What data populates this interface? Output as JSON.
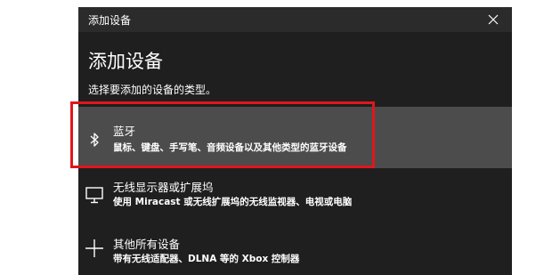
{
  "window": {
    "title": "添加设备"
  },
  "main": {
    "heading": "添加设备",
    "prompt": "选择要添加的设备的类型。"
  },
  "options": [
    {
      "icon": "bluetooth-icon",
      "label": "蓝牙",
      "description": "鼠标、键盘、手写笔、音频设备以及其他类型的蓝牙设备",
      "selected": true
    },
    {
      "icon": "monitor-icon",
      "label": "无线显示器或扩展坞",
      "description": "使用 Miracast 或无线扩展坞的无线监视器、电视或电脑",
      "selected": false
    },
    {
      "icon": "plus-icon",
      "label": "其他所有设备",
      "description": "带有无线适配器、DLNA 等的 Xbox 控制器",
      "selected": false
    }
  ],
  "colors": {
    "dialog_bg": "#1f1f1f",
    "titlebar_bg": "#2b2b2b",
    "selected_bg": "#4c4c4c",
    "annotation_border": "#e0161c"
  }
}
